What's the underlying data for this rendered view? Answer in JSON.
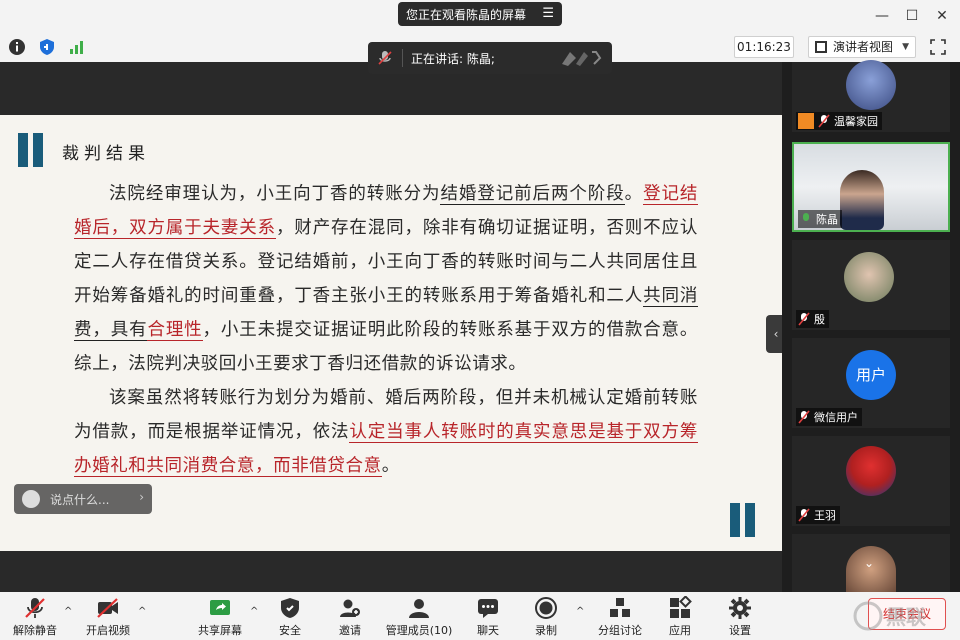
{
  "titlebar": {
    "share_banner": "您正在观看陈晶的屏幕",
    "menu_glyph": "☰",
    "minimize": "—",
    "maximize": "☐",
    "close": "✕"
  },
  "infobar": {
    "timer": "01:16:23",
    "view_label": "演讲者视图"
  },
  "speaker": {
    "label": "正在讲话: 陈晶;"
  },
  "doc": {
    "heading": "裁判结果",
    "p1_a": "法院经审理认为，小王向丁香的转账分为",
    "p1_ul": "结婚登记前后两个阶段",
    "p1_b": "。",
    "p1_red": "登记结婚后，双方属于夫妻关系",
    "p1_c": "，财产存在混同，除非有确切证据证明，否则不应认定二人存在借贷关系。登记结婚前，小王向丁香的转账时间与二人共同居住且开始筹备婚礼的时间重叠，丁香主张小王的转账系用于筹备婚礼和二人",
    "p1_ul2": "共同消费，具有",
    "p1_red2": "合理性",
    "p1_d": "，小王未提交证据证明此阶段的转账系基于双方的借款合意。综上，法院判决驳回小王要求丁香归还借款的诉讼请求。",
    "p2_a": "该案虽然将转账行为划分为婚前、婚后两阶段，但并未机械认定婚前转账为借款，而是根据举证情况，依法",
    "p2_red": "认定当事人转账时的真实意思是基于双方筹办婚礼和共同消费合意，而非借贷合意",
    "p2_b": "。"
  },
  "chat": {
    "placeholder": "说点什么..."
  },
  "gallery": {
    "tiles": [
      {
        "name": "温馨家园"
      },
      {
        "name": "陈晶"
      },
      {
        "name": "殷"
      },
      {
        "name": "微信用户",
        "avatar_text": "用户"
      },
      {
        "name": "王羽"
      },
      {
        "name": ""
      }
    ]
  },
  "bottombar": {
    "unmute": "解除静音",
    "video": "开启视频",
    "share": "共享屏幕",
    "security": "安全",
    "invite": "邀请",
    "participants": "管理成员(10)",
    "chat": "聊天",
    "record": "录制",
    "breakout": "分组讨论",
    "apps": "应用",
    "settings": "设置",
    "end": "结束会议"
  },
  "colors": {
    "accent_green": "#4cb050",
    "red": "#b8252a",
    "blue_avatar": "#1a73e8"
  }
}
